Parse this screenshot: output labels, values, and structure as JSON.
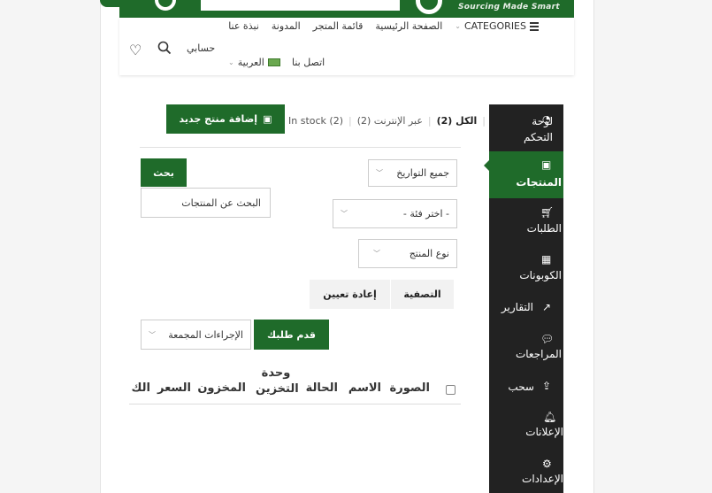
{
  "header": {
    "tagline": "Sourcing Made Smart",
    "nav": {
      "categories": "CATEGORIES",
      "home": "الصفحة الرئيسية",
      "store_list": "قائمة المتجر",
      "blog": "المدونة",
      "about": "نبذة عنا",
      "account": "حسابي",
      "language": "العربية",
      "contact": "اتصل بنا"
    }
  },
  "sidebar": {
    "items": [
      {
        "label": "لوحة التحكم",
        "icon": "gauge-icon"
      },
      {
        "label": "المنتجات",
        "icon": "briefcase-icon",
        "active": true
      },
      {
        "label": "الطلبات",
        "icon": "cart-icon"
      },
      {
        "label": "الكوبونات",
        "icon": "gift-icon"
      },
      {
        "label": "التقارير",
        "icon": "chart-icon"
      },
      {
        "label": "المراجعات",
        "icon": "comments-icon"
      },
      {
        "label": "سحب",
        "icon": "upload-icon"
      },
      {
        "label": "الإعلانات",
        "icon": "bell-icon"
      },
      {
        "label": "الإعدادات",
        "icon": "gear-icon"
      }
    ]
  },
  "products": {
    "tabs": {
      "all": "الكل (2)",
      "online": "عبر الإنترنت (2)",
      "in_stock": "In stock (2)"
    },
    "add_button": "إضافة منتج جديد",
    "filters": {
      "dates": "جميع التواريخ",
      "category": "- اختر فئة -",
      "product_type": "نوع المنتج",
      "search_placeholder": "البحث عن المنتجات",
      "search_button": "بحث",
      "filter_button": "التصفية",
      "reset_button": "إعادة تعيين"
    },
    "bulk": {
      "actions": "الإجراءات المجمعة",
      "submit": "قدم طلبك"
    },
    "table_headers": {
      "image": "الصورة",
      "name": "الاسم",
      "status": "الحالة",
      "sku": "وحدة التخزين",
      "stock": "المخزون",
      "price": "السعر",
      "partial": "الك"
    }
  }
}
